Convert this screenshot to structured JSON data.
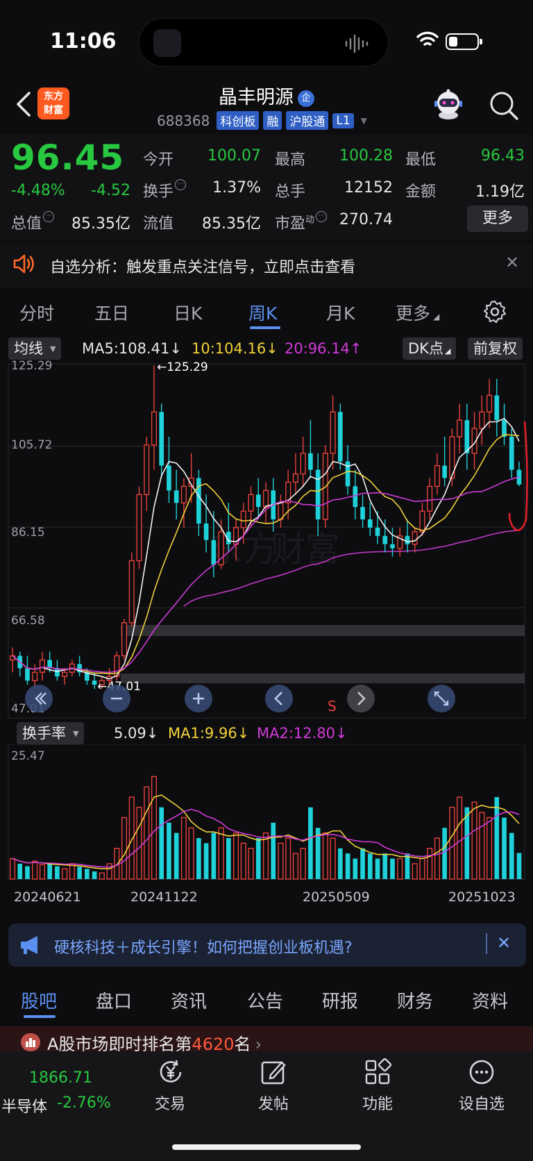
{
  "status": {
    "time": "11:06"
  },
  "header": {
    "logo_line1": "东方",
    "logo_line2": "财富",
    "stock_name": "晶丰明源",
    "ent_badge": "企",
    "code": "688368",
    "tags": [
      "科创板",
      "融",
      "沪股通",
      "L1"
    ]
  },
  "quote": {
    "price": "96.45",
    "change_pct": "-4.48%",
    "change_abs": "-4.52",
    "open_label": "今开",
    "open_value": "100.07",
    "high_label": "最高",
    "high_value": "100.28",
    "low_label": "最低",
    "low_value": "96.43",
    "turnover_label": "换手",
    "turnover_value": "1.37%",
    "volume_label": "总手",
    "volume_value": "12152",
    "amount_label": "金额",
    "amount_value": "1.19亿",
    "mktcap_label": "总值",
    "mktcap_value": "85.35亿",
    "float_label": "流值",
    "float_value": "85.35亿",
    "pe_label": "市盈",
    "pe_sup": "动",
    "pe_value": "270.74",
    "more_label": "更多"
  },
  "alert": {
    "text": "自选分析：触发重点关注信号，立即点击查看"
  },
  "tabs": [
    "分时",
    "五日",
    "日K",
    "周K",
    "月K",
    "更多"
  ],
  "active_tab": "周K",
  "ma_row": {
    "selector": "均线",
    "ma5": "MA5:108.41↓",
    "ma10": "10:104.16↓",
    "ma20": "20:96.14↑",
    "dk": "DK点",
    "adjust": "前复权"
  },
  "chart_controls": {
    "s_marker": "S"
  },
  "vol_row": {
    "selector": "换手率",
    "val": "5.09↓",
    "ma1": "MA1:9.96↓",
    "ma2": "MA2:12.80↓"
  },
  "colors": {
    "up": "#e8413c",
    "down": "#1fd1d9",
    "accent": "#5b8ff0",
    "green": "#28c840"
  },
  "chart_data": {
    "type": "candlestick",
    "y_ticks": [
      "125.29",
      "105.72",
      "86.15",
      "66.58",
      "47.01"
    ],
    "ylim": [
      47.01,
      125.29
    ],
    "annotations": [
      "←125.29",
      "←47.01"
    ],
    "series_labels": [
      "MA5:108.41↓",
      "10:104.16↓",
      "20:96.14↑"
    ],
    "x_ticks": [
      "20240621",
      "20241122",
      "20250509",
      "20251023"
    ],
    "candles": [
      [
        54,
        57,
        51,
        55
      ],
      [
        55,
        56,
        50,
        52
      ],
      [
        52,
        55,
        48,
        49
      ],
      [
        49,
        53,
        47.5,
        51
      ],
      [
        51,
        56,
        49,
        54
      ],
      [
        54,
        56,
        51,
        52
      ],
      [
        52,
        54,
        49,
        50
      ],
      [
        50,
        52,
        48,
        51
      ],
      [
        51,
        54,
        50,
        53
      ],
      [
        53,
        55,
        50,
        51
      ],
      [
        51,
        52,
        48,
        49
      ],
      [
        49,
        51,
        47,
        48
      ],
      [
        48,
        50,
        47.01,
        49
      ],
      [
        49,
        52,
        48,
        50
      ],
      [
        50,
        56,
        49,
        55
      ],
      [
        55,
        64,
        54,
        63
      ],
      [
        63,
        80,
        62,
        78
      ],
      [
        78,
        96,
        76,
        94
      ],
      [
        94,
        108,
        90,
        106
      ],
      [
        106,
        125.29,
        100,
        114
      ],
      [
        114,
        116,
        98,
        101
      ],
      [
        101,
        108,
        92,
        95
      ],
      [
        95,
        100,
        88,
        92
      ],
      [
        92,
        98,
        86,
        96
      ],
      [
        96,
        104,
        92,
        98
      ],
      [
        98,
        100,
        84,
        87
      ],
      [
        87,
        94,
        80,
        83
      ],
      [
        83,
        90,
        74,
        77
      ],
      [
        77,
        88,
        76,
        85
      ],
      [
        85,
        92,
        80,
        82
      ],
      [
        82,
        88,
        78,
        86
      ],
      [
        86,
        92,
        82,
        90
      ],
      [
        90,
        96,
        86,
        94
      ],
      [
        94,
        98,
        88,
        91
      ],
      [
        91,
        97,
        87,
        95
      ],
      [
        95,
        98,
        85,
        88
      ],
      [
        88,
        94,
        86,
        92
      ],
      [
        92,
        100,
        88,
        97
      ],
      [
        97,
        104,
        94,
        99
      ],
      [
        99,
        108,
        96,
        104
      ],
      [
        104,
        112,
        98,
        100
      ],
      [
        100,
        104,
        84,
        88
      ],
      [
        88,
        106,
        86,
        104
      ],
      [
        104,
        118,
        100,
        114
      ],
      [
        114,
        116,
        100,
        102
      ],
      [
        102,
        106,
        94,
        96
      ],
      [
        96,
        100,
        88,
        91
      ],
      [
        91,
        94,
        86,
        88
      ],
      [
        88,
        92,
        84,
        86
      ],
      [
        86,
        90,
        82,
        84
      ],
      [
        84,
        88,
        80,
        82
      ],
      [
        82,
        86,
        79,
        81
      ],
      [
        81,
        86,
        79,
        84
      ],
      [
        84,
        88,
        80,
        82
      ],
      [
        82,
        86,
        80,
        85
      ],
      [
        85,
        92,
        84,
        90
      ],
      [
        90,
        98,
        88,
        96
      ],
      [
        96,
        104,
        94,
        101
      ],
      [
        101,
        108,
        96,
        98
      ],
      [
        98,
        110,
        96,
        108
      ],
      [
        108,
        116,
        104,
        112
      ],
      [
        112,
        116,
        100,
        104
      ],
      [
        104,
        114,
        100,
        110
      ],
      [
        110,
        118,
        106,
        114
      ],
      [
        114,
        122,
        110,
        118
      ],
      [
        118,
        122,
        108,
        112
      ],
      [
        112,
        116,
        106,
        108
      ],
      [
        108,
        110,
        98,
        100
      ],
      [
        100,
        102,
        96,
        96.45
      ]
    ],
    "turnover": [
      4,
      3,
      2.5,
      3.5,
      2.8,
      3,
      2.5,
      2,
      3,
      2.4,
      2,
      1.5,
      1.2,
      3,
      6,
      12,
      16,
      14,
      18,
      20,
      14,
      11,
      9,
      12,
      10,
      8,
      7,
      9,
      10,
      8,
      9,
      7,
      6,
      8,
      9,
      11,
      7,
      8,
      5,
      6,
      14,
      10,
      9,
      8,
      6,
      5,
      4,
      6,
      5,
      4,
      5,
      4,
      4,
      5,
      3,
      4,
      6,
      8,
      10,
      14,
      16,
      14,
      15,
      13,
      12,
      16,
      12,
      9,
      5.09
    ],
    "turnover_labels": [
      "5.09↓",
      "MA1:9.96↓",
      "MA2:12.80↓"
    ],
    "turnover_ylim": [
      0,
      25.47
    ],
    "turnover_top_tick": "25.47"
  },
  "banner": {
    "text": "硬核科技＋成长引擎！如何把握创业板机遇?"
  },
  "sub_tabs": [
    "股吧",
    "盘口",
    "资讯",
    "公告",
    "研报",
    "财务",
    "资料"
  ],
  "rank": {
    "prefix": "A股市场即时排名第",
    "num": "4620",
    "suffix": "名"
  },
  "bottom_nav": {
    "index_value": "1866.71",
    "index_name": "半导体",
    "index_change": "-2.76%",
    "items": [
      "交易",
      "发帖",
      "功能",
      "设自选"
    ]
  }
}
